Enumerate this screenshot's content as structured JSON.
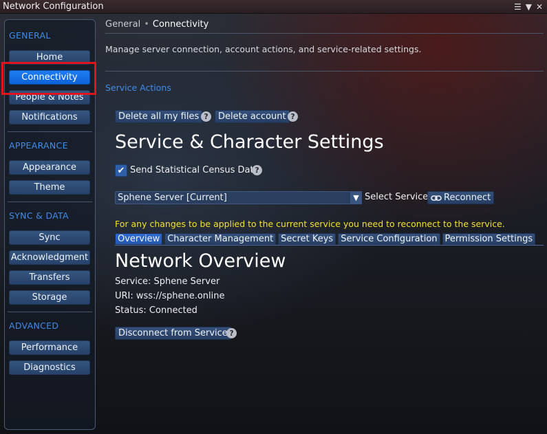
{
  "window": {
    "title": "Network Configuration",
    "controls": [
      "☰",
      "▼",
      "✕"
    ]
  },
  "sidebar": {
    "sections": [
      {
        "label": "GENERAL",
        "items": [
          "Home",
          "Connectivity",
          "People & Notes",
          "Notifications"
        ]
      },
      {
        "label": "APPEARANCE",
        "items": [
          "Appearance",
          "Theme"
        ]
      },
      {
        "label": "SYNC & DATA",
        "items": [
          "Sync",
          "Acknowledgment",
          "Transfers",
          "Storage"
        ]
      },
      {
        "label": "ADVANCED",
        "items": [
          "Performance",
          "Diagnostics"
        ]
      }
    ],
    "active_item": "Connectivity"
  },
  "main": {
    "breadcrumb": {
      "parent": "General",
      "sep": "•",
      "current": "Connectivity"
    },
    "description": "Manage server connection, account actions, and service-related settings.",
    "service_actions_heading": "Service Actions",
    "delete_files_label": "Delete all my files",
    "delete_account_label": "Delete account",
    "help_glyph": "?",
    "settings_title": "Service & Character Settings",
    "census": {
      "label": "Send Statistical Census Data",
      "checked": true
    },
    "service_select": {
      "value": "Sphene Server [Current]",
      "label": "Select Service"
    },
    "reconnect_label": "Reconnect",
    "warning": "For any changes to be applied to the current service you need to reconnect to the service.",
    "tabs": [
      "Overview",
      "Character Management",
      "Secret Keys",
      "Service Configuration",
      "Permission Settings"
    ],
    "active_tab": "Overview",
    "overview": {
      "title": "Network Overview",
      "service": "Service: Sphene Server",
      "uri": "URI: wss://sphene.online",
      "status": "Status: Connected",
      "disconnect_label": "Disconnect from Service"
    }
  },
  "colors": {
    "accent": "#3f8ce8",
    "active_button": "#1e7df2",
    "warning": "#f3e22a",
    "highlight_box": "#e0141c"
  }
}
